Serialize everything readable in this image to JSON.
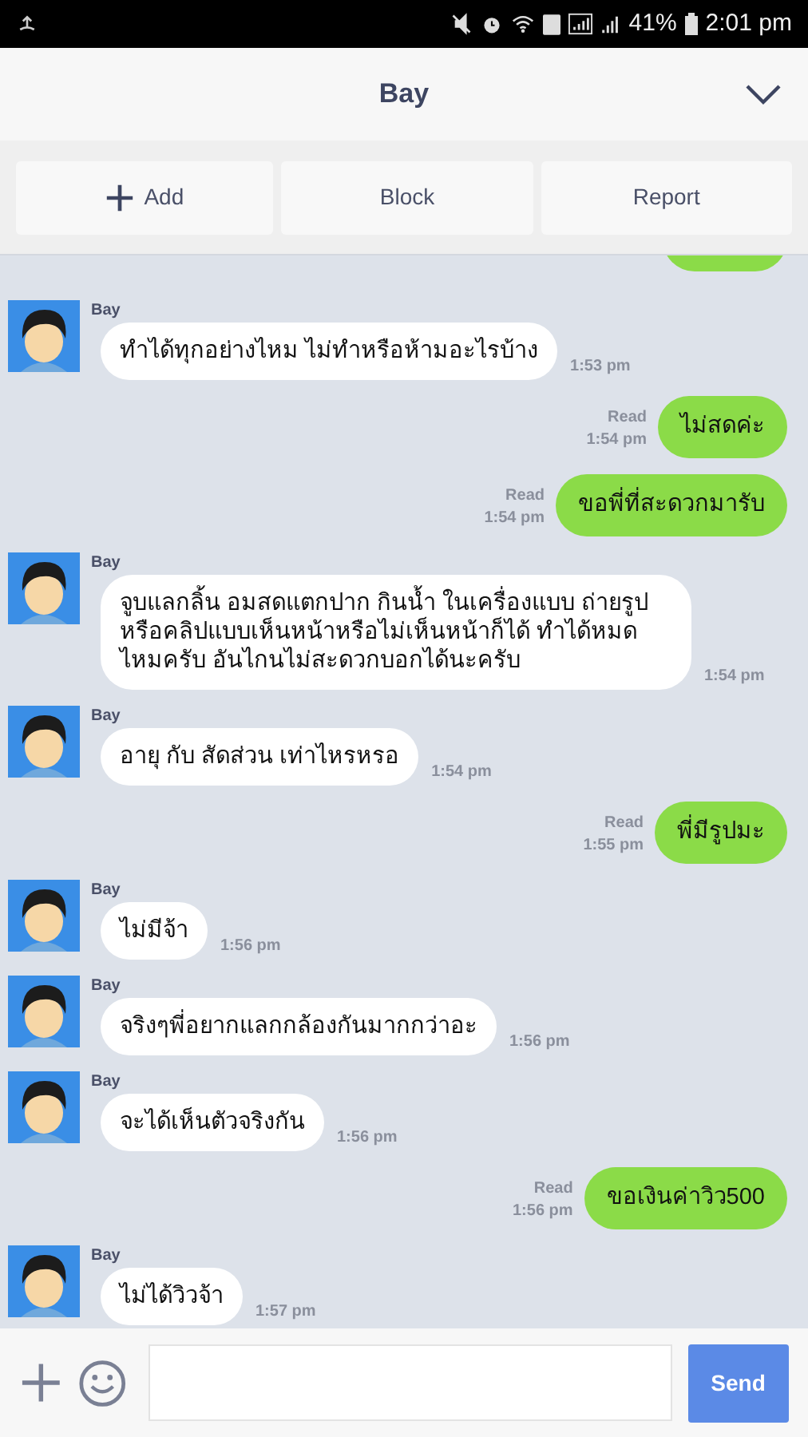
{
  "status_bar": {
    "battery": "41%",
    "time": "2:01 pm"
  },
  "header": {
    "title": "Bay"
  },
  "actions": [
    {
      "kind": "add",
      "label": "Add"
    },
    {
      "kind": "plain",
      "label": "Block"
    },
    {
      "kind": "plain",
      "label": "Report"
    }
  ],
  "messages": [
    {
      "kind": "in",
      "sender": "Bay",
      "text": "ทำได้ทุกอย่างไหม ไม่ทำหรือห้ามอะไรบ้าง",
      "time": "1:53 pm"
    },
    {
      "kind": "out",
      "text": "ไม่สดค่ะ",
      "read": "Read",
      "time": "1:54 pm"
    },
    {
      "kind": "out",
      "text": "ขอพี่ที่สะดวกมารับ",
      "read": "Read",
      "time": "1:54 pm"
    },
    {
      "kind": "in",
      "sender": "Bay",
      "text": "จูบแลกลิ้น อมสดแตกปาก กินน้ำ ในเครื่องแบบ ถ่ายรูปหรือคลิปแบบเห็นหน้าหรือไม่เห็นหน้าก็ได้ ทำได้หมดไหมครับ อันไกนไม่สะดวกบอกได้นะครับ",
      "time": "1:54 pm"
    },
    {
      "kind": "in",
      "sender": "Bay",
      "text": "อายุ กับ สัดส่วน เท่าไหรหรอ",
      "time": "1:54 pm"
    },
    {
      "kind": "out",
      "text": "พี่มีรูปมะ",
      "read": "Read",
      "time": "1:55 pm"
    },
    {
      "kind": "in",
      "sender": "Bay",
      "text": "ไม่มีจ้า",
      "time": "1:56 pm"
    },
    {
      "kind": "in",
      "sender": "Bay",
      "text": "จริงๆพี่อยากแลกกล้องกันมากกว่าอะ",
      "time": "1:56 pm"
    },
    {
      "kind": "in",
      "sender": "Bay",
      "text": "จะได้เห็นตัวจริงกัน",
      "time": "1:56 pm"
    },
    {
      "kind": "out",
      "text": "ขอเงินค่าวิว500",
      "read": "Read",
      "time": "1:56 pm"
    },
    {
      "kind": "in",
      "sender": "Bay",
      "text": "ไม่ได้วิวจ้า",
      "time": "1:57 pm"
    }
  ],
  "composer": {
    "send": "Send"
  }
}
